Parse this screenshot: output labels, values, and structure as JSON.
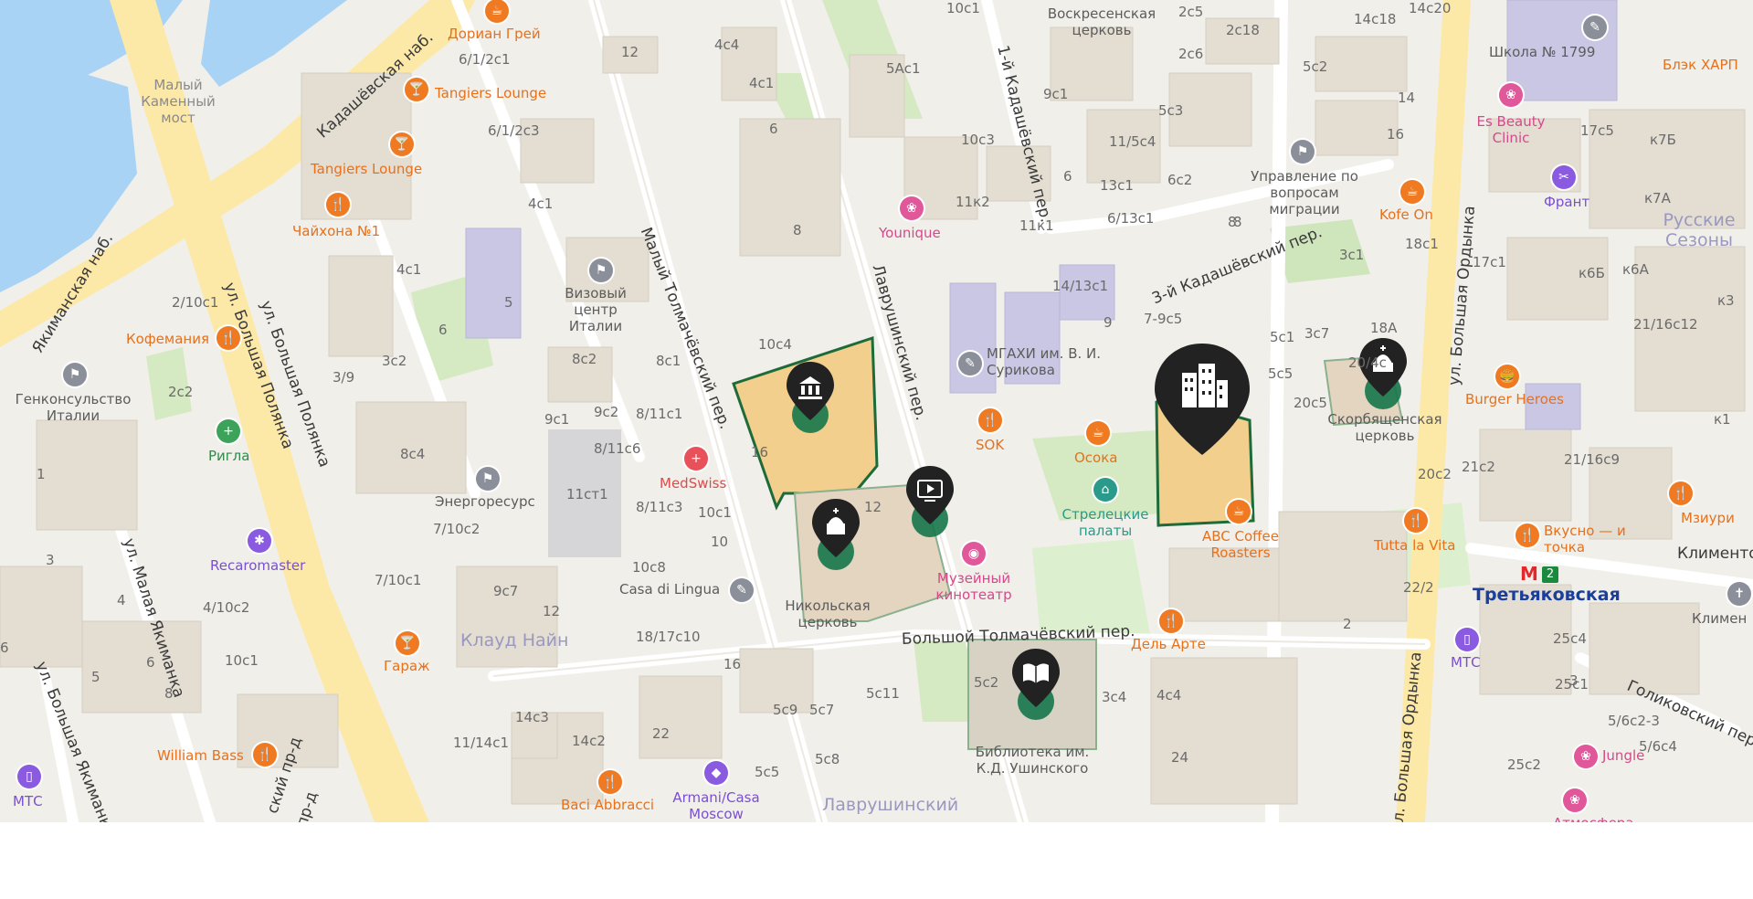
{
  "map": {
    "water_labels": [],
    "streets": [
      {
        "text": "Кадашёвская наб.",
        "name": "street-kadashevskaya-nab"
      },
      {
        "text": "Якиманская наб.",
        "name": "street-yakimanskaya-nab"
      },
      {
        "text": "ул. Большая Полянка",
        "name": "street-bolshaya-polyanka-1"
      },
      {
        "text": "ул. Большая Полянка",
        "name": "street-bolshaya-polyanka-2"
      },
      {
        "text": "ул. Малая Якиманка",
        "name": "street-malaya-yakimanka"
      },
      {
        "text": "ул. Большая Якиманка",
        "name": "street-bolshaya-yakimanka"
      },
      {
        "text": "Малый Толмачёвский пер.",
        "name": "street-maly-tolmachevsky"
      },
      {
        "text": "Лаврушинский пер.",
        "name": "street-lavrushinsky"
      },
      {
        "text": "1-й Кадашёвский пер.",
        "name": "street-1-kadashevsky"
      },
      {
        "text": "3-й Кадашёвский пер.",
        "name": "street-3-kadashevsky"
      },
      {
        "text": "ул. Большая Ордынка",
        "name": "street-bolshaya-ordynka-1"
      },
      {
        "text": "ул. Большая Ордынка",
        "name": "street-bolshaya-ordynka-2"
      },
      {
        "text": "Большой Толмачёвский пер.",
        "name": "street-bolshoy-tolmachevsky"
      },
      {
        "text": "Голиковский пер.",
        "name": "street-golikovsky"
      },
      {
        "text": "Климентовский пер.",
        "name": "street-klimentovsky"
      },
      {
        "text": "ский пр-д",
        "name": "street-partial-1"
      },
      {
        "text": "пр-д",
        "name": "street-partial-2"
      }
    ],
    "places": [
      {
        "text": "Малый Каменный мост",
        "name": "bridge-maly-kamenny"
      },
      {
        "text": "Генконсульство Италии",
        "name": "place-genkonsulstvo"
      },
      {
        "text": "Визовый центр Италии",
        "name": "place-vizovy-centr"
      },
      {
        "text": "Энергоресурс",
        "name": "place-energoresurs"
      },
      {
        "text": "Casa di Lingua",
        "name": "place-casa-di-lingua"
      },
      {
        "text": "Никольская церковь",
        "name": "place-nikolskaya"
      },
      {
        "text": "МГАХИ им. В. И. Сурикова",
        "name": "place-mgahi"
      },
      {
        "text": "Управление по вопросам миграции",
        "name": "place-upravlenie"
      },
      {
        "text": "Воскресенская церковь",
        "name": "place-voskresenskaya"
      },
      {
        "text": "Школа № 1799",
        "name": "place-shkola"
      },
      {
        "text": "Скорбященская церковь",
        "name": "place-skorbyashchenskaya"
      },
      {
        "text": "Библиотека им. К.Д. Ушинского",
        "name": "place-biblioteka"
      },
      {
        "text": "Климентовская церковь",
        "name": "place-klimentovskaya"
      }
    ],
    "districts": [
      {
        "text": "Клауд Найн",
        "name": "district-klaud-nayn"
      },
      {
        "text": "Лаврушинский",
        "name": "district-lavrushinsky"
      },
      {
        "text": "Русские Сезоны",
        "name": "district-russkie-sezony"
      }
    ],
    "pois": [
      {
        "text": "Дориан Грей",
        "name": "poi-dorian-grey",
        "glyph": "☕",
        "color": "#f07a22"
      },
      {
        "text": "Tangiers Lounge",
        "name": "poi-tangiers-lounge-1",
        "glyph": "🍸",
        "color": "#f07a22"
      },
      {
        "text": "Tangiers Lounge",
        "name": "poi-tangiers-lounge-2",
        "glyph": "🍸",
        "color": "#f07a22"
      },
      {
        "text": "Чайхона №1",
        "name": "poi-chayhona",
        "glyph": "🍴",
        "color": "#f07a22"
      },
      {
        "text": "Кофемания",
        "name": "poi-kofemaniya",
        "glyph": "🍴",
        "color": "#f07a22"
      },
      {
        "text": "Ригла",
        "name": "poi-rigla",
        "glyph": "+",
        "color": "#3ea35a"
      },
      {
        "text": "Recaromaster",
        "name": "poi-recaromaster",
        "glyph": "✱",
        "color": "#8a5ae0"
      },
      {
        "text": "Гараж",
        "name": "poi-garazh",
        "glyph": "🍸",
        "color": "#f07a22"
      },
      {
        "text": "William Bass",
        "name": "poi-william-bass",
        "glyph": "🍴",
        "color": "#f07a22"
      },
      {
        "text": "МТС",
        "name": "poi-mts-1",
        "glyph": "▯",
        "color": "#8a5ae0"
      },
      {
        "text": "Baci Abbracci",
        "name": "poi-baci-abbracci",
        "glyph": "🍴",
        "color": "#f07a22"
      },
      {
        "text": "Armani/Casa Moscow",
        "name": "poi-armani-casa",
        "glyph": "◆",
        "color": "#8a5ae0"
      },
      {
        "text": "MedSwiss",
        "name": "poi-medswiss",
        "glyph": "+",
        "color": "#e8505a"
      },
      {
        "text": "Younique",
        "name": "poi-younique",
        "glyph": "❀",
        "color": "#e0589a"
      },
      {
        "text": "SOK",
        "name": "poi-sok",
        "glyph": "🍴",
        "color": "#f07a22"
      },
      {
        "text": "Осока",
        "name": "poi-osoka",
        "glyph": "☕",
        "color": "#f07a22"
      },
      {
        "text": "Стрелецкие палаты",
        "name": "poi-streletskie-palaty",
        "glyph": "⌂",
        "color": "#2a9a8a"
      },
      {
        "text": "Музейный кинотеатр",
        "name": "poi-muzeyny-kinoteatr",
        "glyph": "◉",
        "color": "#e0589a"
      },
      {
        "text": "ABC Coffee Roasters",
        "name": "poi-abc-coffee",
        "glyph": "☕",
        "color": "#f07a22"
      },
      {
        "text": "Дель Арте",
        "name": "poi-del-arte",
        "glyph": "🍴",
        "color": "#f07a22"
      },
      {
        "text": "Tutta la Vita",
        "name": "poi-tutta-la-vita",
        "glyph": "🍴",
        "color": "#f07a22"
      },
      {
        "text": "Burger Heroes",
        "name": "poi-burger-heroes",
        "glyph": "🍔",
        "color": "#f07a22"
      },
      {
        "text": "Kofe On",
        "name": "poi-kofe-on",
        "glyph": "☕",
        "color": "#f07a22"
      },
      {
        "text": "Es Beauty Clinic",
        "name": "poi-es-beauty",
        "glyph": "❀",
        "color": "#e0589a"
      },
      {
        "text": "Франт",
        "name": "poi-frant",
        "glyph": "✂",
        "color": "#8a5ae0"
      },
      {
        "text": "Блэк ХАРП",
        "name": "poi-blek-harp",
        "glyph": "",
        "color": "#f07a22"
      },
      {
        "text": "Мзиури",
        "name": "poi-mziuri",
        "glyph": "🍴",
        "color": "#f07a22"
      },
      {
        "text": "Вкусно — и точка",
        "name": "poi-vkusno-i-tochka",
        "glyph": "🍴",
        "color": "#f07a22"
      },
      {
        "text": "МТС",
        "name": "poi-mts-2",
        "glyph": "▯",
        "color": "#8a5ae0"
      },
      {
        "text": "Jungle",
        "name": "poi-jungle",
        "glyph": "❀",
        "color": "#e0589a"
      },
      {
        "text": "Атмосфера",
        "name": "poi-atmosfera",
        "glyph": "❀",
        "color": "#e0589a"
      }
    ],
    "metro": {
      "name": "Третьяковская",
      "line": "2",
      "symbol": "М"
    },
    "house_numbers": [
      "12",
      "4с4",
      "4с1",
      "6",
      "8",
      "5Ас1",
      "10с1",
      "9с1",
      "10с3",
      "11к2",
      "11к1",
      "14/13с1",
      "2с5",
      "2с6",
      "2с18",
      "5с3",
      "11/5с4",
      "6с2",
      "13с1",
      "6/13с1",
      "5с2",
      "14с18",
      "14с20",
      "14",
      "16",
      "17с5",
      "к7Б",
      "к7А",
      "18с1",
      "3с1",
      "17с1",
      "к6Б",
      "к6А",
      "к3",
      "21/16с12",
      "к1",
      "21с2",
      "21/16с9",
      "20с2",
      "22/2",
      "2",
      "3",
      "25с4",
      "25с1",
      "5/6с2-3",
      "5/6с4",
      "25с2",
      "24",
      "9",
      "7-9с5",
      "5с1",
      "3с7",
      "18А",
      "5с5",
      "20/4с",
      "20с5",
      "8",
      "16",
      "6/1/2с1",
      "6/1/2с3",
      "4с1",
      "5",
      "4с1",
      "6",
      "2/10с1",
      "2с2",
      "3/9",
      "3с2",
      "8с2",
      "8с1",
      "9с2",
      "9с1",
      "8/11с1",
      "8/11с6",
      "8/11с3",
      "8с4",
      "11ст1",
      "10с4",
      "12",
      "10с1",
      "10",
      "10с8",
      "7/10с2",
      "7/10с1",
      "9с7",
      "12",
      "1",
      "3",
      "4",
      "4/10с2",
      "6",
      "5",
      "8",
      "10с1",
      "6",
      "18/17с10",
      "16",
      "14с3",
      "14с2",
      "11/14с1",
      "22",
      "5с9",
      "5с7",
      "5с11",
      "5с5",
      "5с8",
      "3с4",
      "4с4",
      "5с2",
      "6",
      "8"
    ]
  }
}
